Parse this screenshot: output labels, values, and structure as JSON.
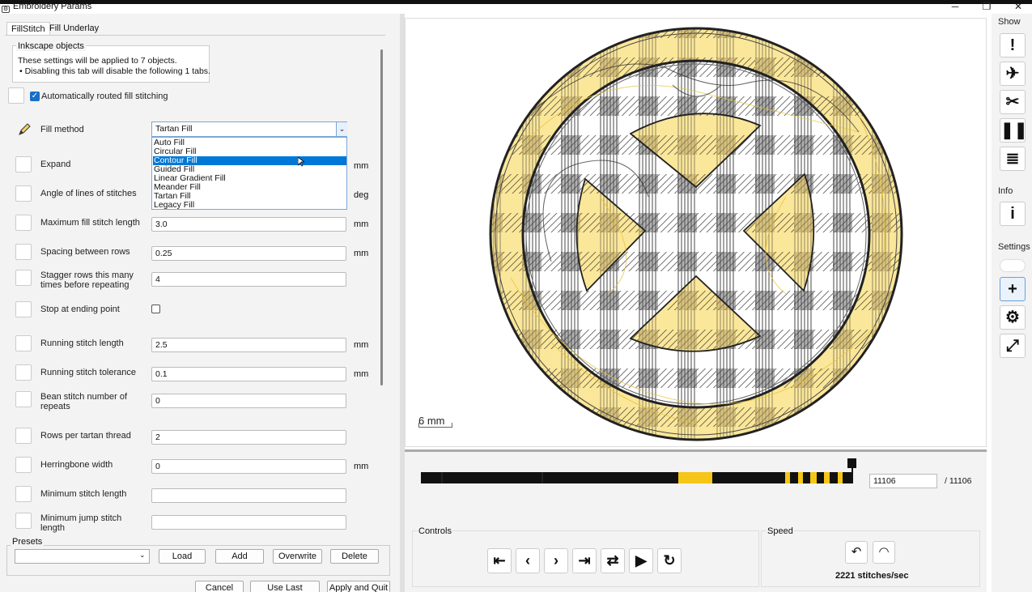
{
  "window": {
    "title": "Embroidery Params",
    "minimize": "─",
    "restore": "❐",
    "close": "✕"
  },
  "tabs": [
    {
      "label": "FillStitch"
    },
    {
      "label": "Fill Underlay"
    }
  ],
  "inkscape": {
    "legend": "Inkscape objects",
    "line1": "These settings will be applied to 7 objects.",
    "line2": "• Disabling this tab will disable the following 1 tabs."
  },
  "auto_route": {
    "label": "Automatically routed fill stitching",
    "checked": true
  },
  "fill_method": {
    "label": "Fill method",
    "value": "Tartan Fill",
    "options": [
      "Auto Fill",
      "Circular Fill",
      "Contour Fill",
      "Guided Fill",
      "Linear Gradient Fill",
      "Meander Fill",
      "Tartan Fill",
      "Legacy Fill"
    ],
    "highlighted": "Contour Fill"
  },
  "params": [
    {
      "label": "Expand",
      "value": "",
      "unit": "mm"
    },
    {
      "label": "Angle of lines of stitches",
      "value": "",
      "unit": "deg"
    },
    {
      "label": "Maximum fill stitch length",
      "value": "3.0",
      "unit": "mm"
    },
    {
      "label": "Spacing between rows",
      "value": "0.25",
      "unit": "mm"
    },
    {
      "label": "Stagger rows this many times before repeating",
      "value": "4",
      "unit": ""
    },
    {
      "label": "Stop at ending point",
      "value": "",
      "unit": ""
    },
    {
      "label": "Running stitch length",
      "value": "2.5",
      "unit": "mm"
    },
    {
      "label": "Running stitch tolerance",
      "value": "0.1",
      "unit": "mm"
    },
    {
      "label": "Bean stitch number of repeats",
      "value": "0",
      "unit": ""
    },
    {
      "label": "Rows per tartan thread",
      "value": "2",
      "unit": ""
    },
    {
      "label": "Herringbone width",
      "value": "0",
      "unit": "mm"
    },
    {
      "label": "Minimum stitch length",
      "value": "",
      "unit": ""
    },
    {
      "label": "Minimum jump stitch length",
      "value": "",
      "unit": ""
    }
  ],
  "presets": {
    "legend": "Presets",
    "load": "Load",
    "add": "Add",
    "overwrite": "Overwrite",
    "delete": "Delete"
  },
  "footer": {
    "cancel": "Cancel",
    "use_last": "Use Last Settings",
    "apply_quit": "Apply and Quit"
  },
  "preview": {
    "scale_label": "6 mm"
  },
  "simulator": {
    "current_stitch": "11106",
    "total": "/ 11106",
    "progress": 1.0,
    "controls_legend": "Controls",
    "speed_legend": "Speed",
    "speed": "2221 stitches/sec"
  },
  "sidebar": {
    "show": "Show",
    "info": "Info",
    "settings": "Settings"
  },
  "colors": {
    "accent": "#0078d7",
    "thread_yellow": "#f5c518",
    "thread_black": "#111111"
  }
}
